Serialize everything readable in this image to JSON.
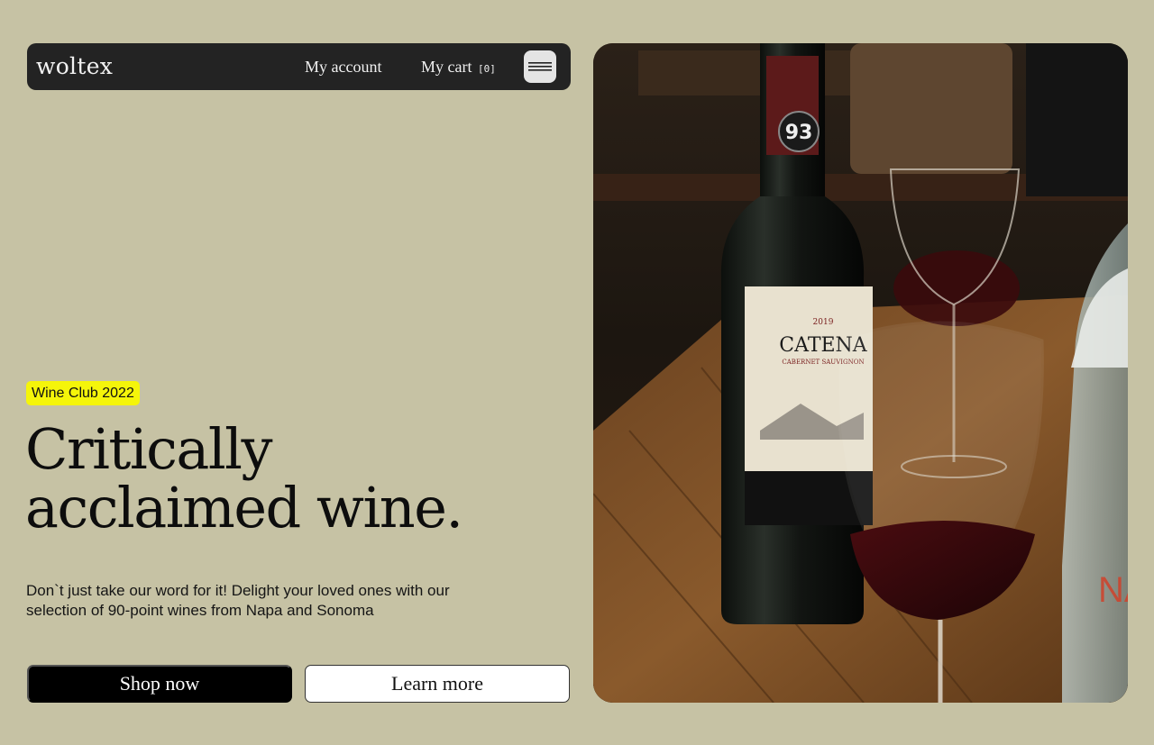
{
  "nav": {
    "logo": "woltex",
    "account_label": "My account",
    "cart_label": "My cart",
    "cart_count": "[0]",
    "menu_icon": "hamburger-menu-icon"
  },
  "hero": {
    "badge": "Wine Club 2022",
    "headline_line1": "Critically",
    "headline_line2": "acclaimed wine.",
    "description": "Don`t just take our word for it! Delight your loved ones with our selection of 90-point wines from Napa and Sonoma",
    "primary_button": "Shop now",
    "secondary_button": "Learn more"
  },
  "photo": {
    "label_brand": "CATENA",
    "label_sub": "CABERNET SAUVIGNON",
    "label_year": "2019",
    "score": "93"
  },
  "colors": {
    "background": "#c6c2a4",
    "navbar": "#232323",
    "badge": "#f5f50a",
    "primary_button": "#000000"
  }
}
